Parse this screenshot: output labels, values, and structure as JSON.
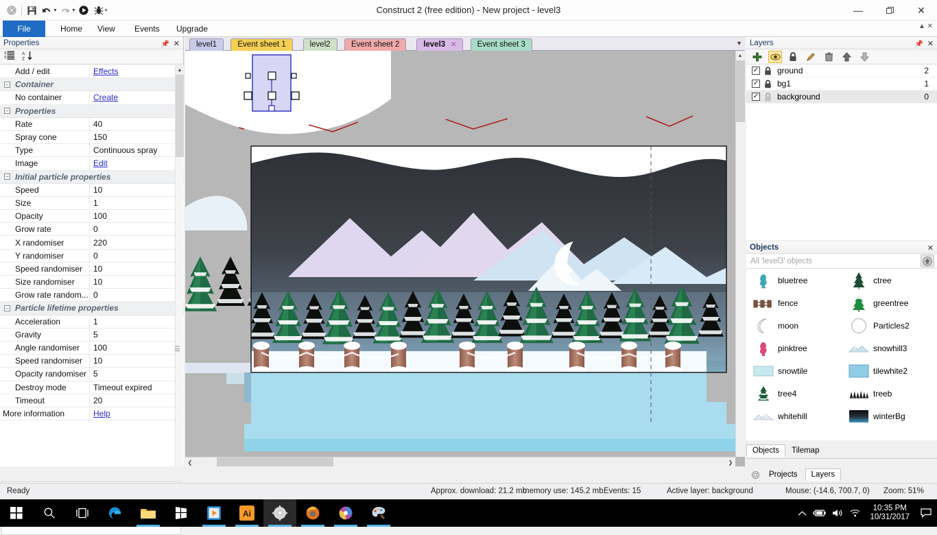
{
  "window": {
    "title": "Construct 2  (free edition) - New project - level3",
    "minimize": "—",
    "restore": "❐",
    "close": "✕"
  },
  "quick_access": {
    "icons": [
      "construct-logo-icon",
      "save-icon",
      "undo-icon",
      "redo-icon",
      "run-icon",
      "debug-icon",
      "customize-icon"
    ]
  },
  "ribbon": {
    "tabs": [
      {
        "label": "File",
        "selected": true
      },
      {
        "label": "Home",
        "selected": false
      },
      {
        "label": "View",
        "selected": false
      },
      {
        "label": "Events",
        "selected": false
      },
      {
        "label": "Upgrade",
        "selected": false
      }
    ]
  },
  "properties": {
    "title": "Properties",
    "toolbar": [
      "categorize-icon",
      "sort-alphabetical-icon"
    ],
    "rows": [
      {
        "kind": "prop",
        "name": "Add / edit",
        "value": "Effects",
        "link": true
      },
      {
        "kind": "group",
        "name": "Container"
      },
      {
        "kind": "prop",
        "name": "No container",
        "value": "Create",
        "link": true
      },
      {
        "kind": "group",
        "name": "Properties"
      },
      {
        "kind": "prop",
        "name": "Rate",
        "value": "40"
      },
      {
        "kind": "prop",
        "name": "Spray cone",
        "value": "150"
      },
      {
        "kind": "prop",
        "name": "Type",
        "value": "Continuous spray"
      },
      {
        "kind": "prop",
        "name": "Image",
        "value": "Edit",
        "link": true
      },
      {
        "kind": "group",
        "name": "Initial particle properties"
      },
      {
        "kind": "prop",
        "name": "Speed",
        "value": "10"
      },
      {
        "kind": "prop",
        "name": "Size",
        "value": "1"
      },
      {
        "kind": "prop",
        "name": "Opacity",
        "value": "100"
      },
      {
        "kind": "prop",
        "name": "Grow rate",
        "value": "0"
      },
      {
        "kind": "prop",
        "name": "X randomiser",
        "value": "220"
      },
      {
        "kind": "prop",
        "name": "Y randomiser",
        "value": "0"
      },
      {
        "kind": "prop",
        "name": "Speed randomiser",
        "value": "10"
      },
      {
        "kind": "prop",
        "name": "Size randomiser",
        "value": "10"
      },
      {
        "kind": "prop",
        "name": "Grow rate random...",
        "value": "0"
      },
      {
        "kind": "group",
        "name": "Particle lifetime properties"
      },
      {
        "kind": "prop",
        "name": "Acceleration",
        "value": "1"
      },
      {
        "kind": "prop",
        "name": "Gravity",
        "value": "5"
      },
      {
        "kind": "prop",
        "name": "Angle randomiser",
        "value": "100"
      },
      {
        "kind": "prop",
        "name": "Speed randomiser",
        "value": "10"
      },
      {
        "kind": "prop",
        "name": "Opacity randomiser",
        "value": "5"
      },
      {
        "kind": "prop",
        "name": "Destroy mode",
        "value": "Timeout expired"
      },
      {
        "kind": "prop",
        "name": "Timeout",
        "value": "20"
      },
      {
        "kind": "footer",
        "name": "More information",
        "value": "Help",
        "link": true
      }
    ]
  },
  "layout_tabs": [
    {
      "label": "level1",
      "color": "#c9cbe8",
      "selected": false,
      "close": false
    },
    {
      "label": "Event sheet 1",
      "color": "#f5cf52",
      "selected": false,
      "close": false
    },
    {
      "label": "level2",
      "color": "#cfe0c6",
      "selected": false,
      "close": false
    },
    {
      "label": "Event sheet 2",
      "color": "#f0a9a9",
      "selected": false,
      "close": false
    },
    {
      "label": "level3",
      "color": "#d9b9e8",
      "selected": true,
      "close": true
    },
    {
      "label": "Event sheet 3",
      "color": "#a8dcc8",
      "selected": false,
      "close": false
    }
  ],
  "layers": {
    "title": "Layers",
    "tools": [
      "add-layer-icon",
      "eye-icon",
      "lock-icon",
      "pencil-icon",
      "trash-icon",
      "move-up-icon",
      "move-down-icon"
    ],
    "items": [
      {
        "name": "ground",
        "number": "2",
        "visible": true,
        "locked": true,
        "selected": false
      },
      {
        "name": "bg1",
        "number": "1",
        "visible": true,
        "locked": true,
        "selected": false
      },
      {
        "name": "background",
        "number": "0",
        "visible": true,
        "locked": false,
        "selected": true
      }
    ]
  },
  "objects": {
    "title": "Objects",
    "filter_placeholder": "All 'level3' objects",
    "items": [
      {
        "name": "bluetree",
        "icon": "bluetree-icon"
      },
      {
        "name": "ctree",
        "icon": "ctree-icon"
      },
      {
        "name": "fence",
        "icon": "fence-icon"
      },
      {
        "name": "greentree",
        "icon": "greentree-icon"
      },
      {
        "name": "moon",
        "icon": "moon-icon"
      },
      {
        "name": "Particles2",
        "icon": "particles-icon"
      },
      {
        "name": "pinktree",
        "icon": "pinktree-icon"
      },
      {
        "name": "snowhill3",
        "icon": "snowhill-icon"
      },
      {
        "name": "snowtile",
        "icon": "snowtile-icon"
      },
      {
        "name": "tilewhite2",
        "icon": "tilewhite-icon"
      },
      {
        "name": "tree4",
        "icon": "tree4-icon"
      },
      {
        "name": "treeb",
        "icon": "treeb-icon"
      },
      {
        "name": "whitehill",
        "icon": "whitehill-icon"
      },
      {
        "name": "winterBg",
        "icon": "winterbg-icon"
      }
    ]
  },
  "dock_tabs": {
    "upper": [
      {
        "label": "Objects",
        "selected": true
      },
      {
        "label": "Tilemap",
        "selected": false
      }
    ],
    "lower": [
      {
        "label": "Projects",
        "selected": false
      },
      {
        "label": "Layers",
        "selected": true
      }
    ]
  },
  "status": {
    "ready": "Ready",
    "download": "Approx. download: 21.2 mb",
    "memory": "memory use: 145.2 mb",
    "events": "Events: 15",
    "active_layer": "Active layer: background",
    "mouse": "Mouse: (-14.6, 700.7, 0)",
    "zoom": "Zoom: 51%"
  },
  "taskbar": {
    "items": [
      {
        "icon": "windows-start-icon",
        "running": false
      },
      {
        "icon": "search-icon",
        "running": false
      },
      {
        "icon": "task-view-icon",
        "running": false
      },
      {
        "icon": "edge-icon",
        "running": false
      },
      {
        "icon": "file-explorer-icon",
        "running": true
      },
      {
        "icon": "store-icon",
        "running": false
      },
      {
        "icon": "media-player-icon",
        "running": true
      },
      {
        "icon": "illustrator-icon",
        "running": true
      },
      {
        "icon": "construct2-icon",
        "running": true
      },
      {
        "icon": "firefox-icon",
        "running": true
      },
      {
        "icon": "photo-editor-icon",
        "running": true
      },
      {
        "icon": "paint-icon",
        "running": true
      }
    ],
    "tray": [
      "chevron-up-icon",
      "battery-icon",
      "volume-icon",
      "wifi-icon"
    ],
    "time": "10:35 PM",
    "date": "10/31/2017",
    "action_center": "action-center-icon"
  },
  "colors": {
    "accent": "#1f6cc4",
    "selection": "#2b2bbd",
    "link": "#2a29c9",
    "layer_selected_bg": "#e8e8e8"
  }
}
